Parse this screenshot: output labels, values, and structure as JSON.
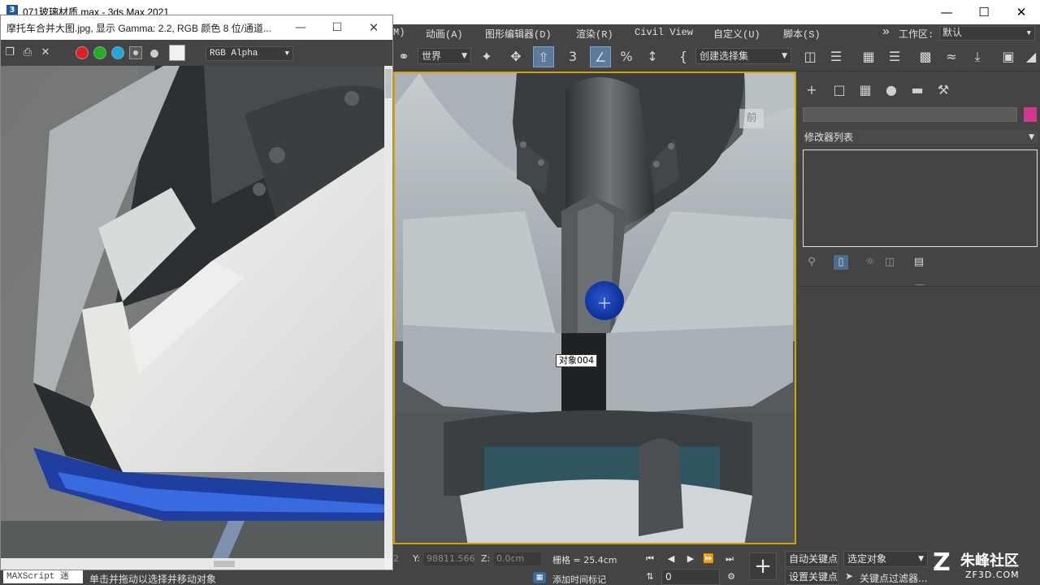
{
  "app": {
    "title": "071玻璃材质.max - 3ds Max 2021",
    "logo_text": "3"
  },
  "menubar": {
    "partial": "M)",
    "items": [
      "动画(A)",
      "图形编辑器(D)",
      "渲染(R)",
      "Civil View",
      "自定义(U)",
      "脚本(S)"
    ],
    "overflow": "»",
    "workspace_label": "工作区:",
    "workspace_value": "默认"
  },
  "toolbar": {
    "coord_system": "世界",
    "selection_set": "创建选择集"
  },
  "viewport": {
    "label_front": "前",
    "tooltip": "对象004"
  },
  "command_panel": {
    "modifier_list": "修改器列表",
    "name_value": ""
  },
  "status": {
    "coord_x_prefix": "2",
    "coord_y_label": "Y:",
    "coord_y_value": "98811.566",
    "coord_z_label": "Z:",
    "coord_z_value": "0.0cm",
    "grid": "栅格 = 25.4cm",
    "frame_value": "0",
    "add_time_tag": "添加时间标记",
    "auto_key": "自动关键点",
    "set_key": "设置关键点",
    "selected_object": "选定对象",
    "key_filters": "关键点过滤器..."
  },
  "bottom_left": {
    "maxscript": "MAXScript 迷",
    "prompt": "单击并拖动以选择并移动对象"
  },
  "frame_buffer": {
    "title": "摩托车合并大图.jpg, 显示 Gamma: 2.2, RGB 颜色 8 位/通道...",
    "channel": "RGB Alpha"
  },
  "watermark": {
    "brand": "朱峰社区",
    "site": "ZF3D.COM"
  },
  "colors": {
    "viewport_border": "#d6a200",
    "object_color": "#d03a8a",
    "red_channel": "#e02020",
    "green_channel": "#20b020",
    "blue_channel": "#20a8e0"
  }
}
